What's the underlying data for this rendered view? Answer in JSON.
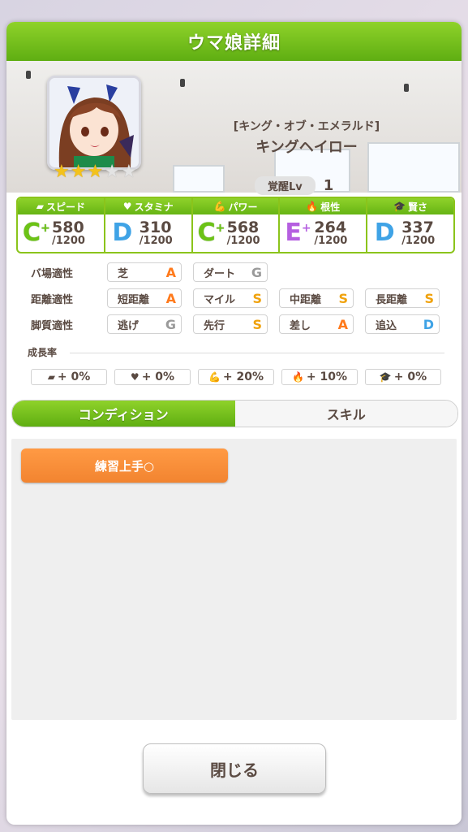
{
  "header": {
    "title": "ウマ娘詳細"
  },
  "character": {
    "epithet": "[キング・オブ・エメラルド]",
    "name": "キングヘイロー",
    "awakening_label": "覚醒Lv",
    "awakening_level": "1",
    "stars_filled": 3,
    "stars_total": 5
  },
  "stats": [
    {
      "label": "スピード",
      "icon": "shoe-icon",
      "grade": "C",
      "plus": true,
      "value": "580",
      "max": "/1200"
    },
    {
      "label": "スタミナ",
      "icon": "heart-icon",
      "grade": "D",
      "plus": false,
      "value": "310",
      "max": "/1200"
    },
    {
      "label": "パワー",
      "icon": "muscle-icon",
      "grade": "C",
      "plus": true,
      "value": "568",
      "max": "/1200"
    },
    {
      "label": "根性",
      "icon": "flame-icon",
      "grade": "E",
      "plus": true,
      "value": "264",
      "max": "/1200"
    },
    {
      "label": "賢さ",
      "icon": "graduation-cap-icon",
      "grade": "D",
      "plus": false,
      "value": "337",
      "max": "/1200"
    }
  ],
  "aptitudes": {
    "surface": {
      "label": "バ場適性",
      "items": [
        {
          "name": "芝",
          "grade": "A"
        },
        {
          "name": "ダート",
          "grade": "G"
        }
      ]
    },
    "distance": {
      "label": "距離適性",
      "items": [
        {
          "name": "短距離",
          "grade": "A"
        },
        {
          "name": "マイル",
          "grade": "S"
        },
        {
          "name": "中距離",
          "grade": "S"
        },
        {
          "name": "長距離",
          "grade": "S"
        }
      ]
    },
    "style": {
      "label": "脚質適性",
      "items": [
        {
          "name": "逃げ",
          "grade": "G"
        },
        {
          "name": "先行",
          "grade": "S"
        },
        {
          "name": "差し",
          "grade": "A"
        },
        {
          "name": "追込",
          "grade": "D"
        }
      ]
    }
  },
  "growth": {
    "label": "成長率",
    "items": [
      {
        "icon": "shoe-icon",
        "value": "+ 0%"
      },
      {
        "icon": "heart-icon",
        "value": "+ 0%"
      },
      {
        "icon": "muscle-icon",
        "value": "+ 20%"
      },
      {
        "icon": "flame-icon",
        "value": "+ 10%"
      },
      {
        "icon": "graduation-cap-icon",
        "value": "+ 0%"
      }
    ]
  },
  "tabs": {
    "condition": "コンディション",
    "skill": "スキル"
  },
  "conditions": [
    "練習上手○"
  ],
  "close_button": "閉じる",
  "colors": {
    "accent_green": "#6cbf17",
    "condition_orange": "#f28430",
    "text_brown": "#5a4a42"
  }
}
